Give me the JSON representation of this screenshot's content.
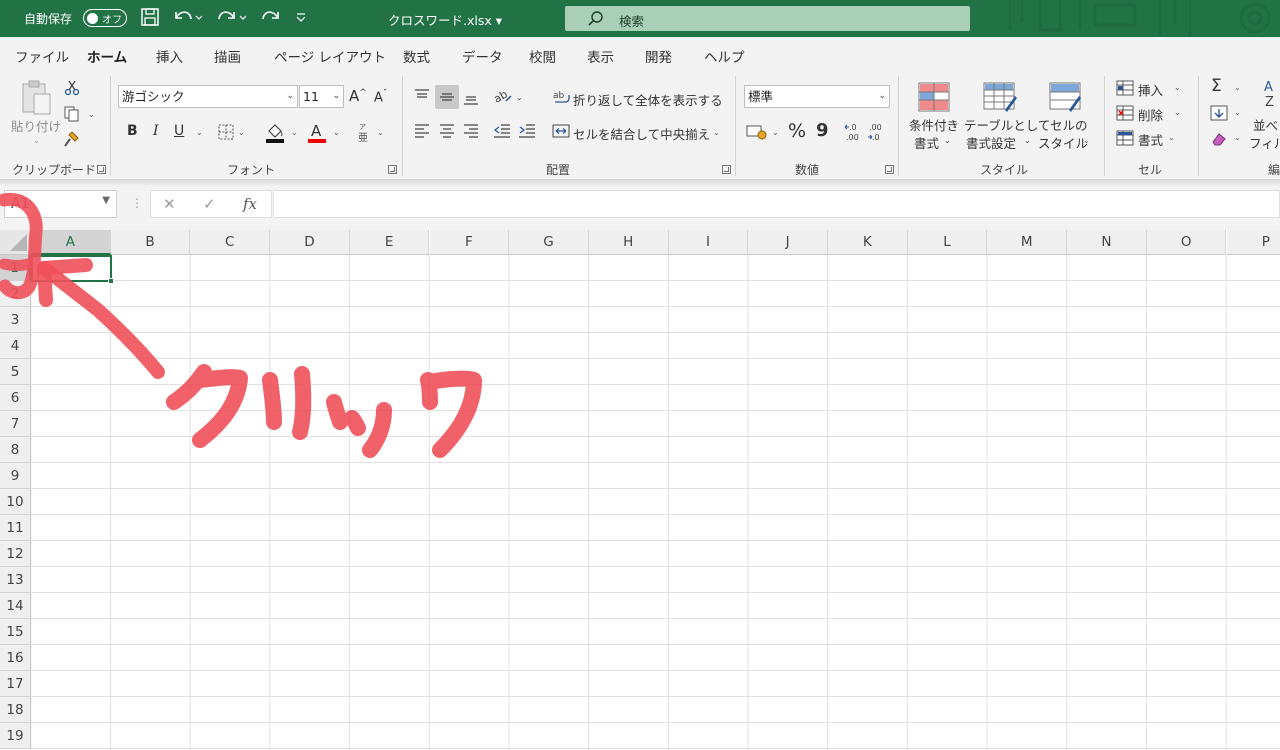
{
  "titlebar": {
    "autosave_label": "自動保存",
    "autosave_state": "オフ",
    "filename": "クロスワード.xlsx",
    "search_placeholder": "検索"
  },
  "menu_tabs": [
    "ファイル",
    "ホーム",
    "挿入",
    "描画",
    "ページ レイアウト",
    "数式",
    "データ",
    "校閲",
    "表示",
    "開発",
    "ヘルプ"
  ],
  "active_tab": "ホーム",
  "ribbon": {
    "clipboard": {
      "paste": "貼り付け",
      "label": "クリップボード"
    },
    "font": {
      "name": "游ゴシック",
      "size": "11",
      "label": "フォント",
      "bold": "B",
      "italic": "I",
      "underline": "U"
    },
    "alignment": {
      "wrap": "折り返して全体を表示する",
      "merge": "セルを結合して中央揃え",
      "label": "配置"
    },
    "number": {
      "format": "標準",
      "label": "数値",
      "percent": "%",
      "comma": "9"
    },
    "styles": {
      "conditional_1": "条件付き",
      "conditional_2": "書式",
      "table_1": "テーブルとして",
      "table_2": "書式設定",
      "cell_1": "セルの",
      "cell_2": "スタイル",
      "label": "スタイル"
    },
    "cells": {
      "insert": "挿入",
      "delete": "削除",
      "format": "書式",
      "label": "セル"
    },
    "editing": {
      "sort_1": "並べ",
      "sort_2": "フィル",
      "label_partial": "編"
    }
  },
  "formula_bar": {
    "name_box": "A1",
    "fx": "fx",
    "cancel": "✕",
    "enter": "✓"
  },
  "columns": [
    "A",
    "B",
    "C",
    "D",
    "E",
    "F",
    "G",
    "H",
    "I",
    "J",
    "K",
    "L",
    "M",
    "N",
    "O",
    "P"
  ],
  "rows": [
    "1",
    "2",
    "3",
    "4",
    "5",
    "6",
    "7",
    "8",
    "9",
    "10",
    "11",
    "12",
    "13",
    "14",
    "15",
    "16",
    "17",
    "18",
    "19"
  ],
  "active_cell": "A1",
  "annotation": {
    "text": "クリック",
    "color": "#f0505a"
  },
  "colors": {
    "excel_green": "#217346",
    "ribbon_bg": "#f3f3f3",
    "annotation_red": "#f0505a"
  }
}
